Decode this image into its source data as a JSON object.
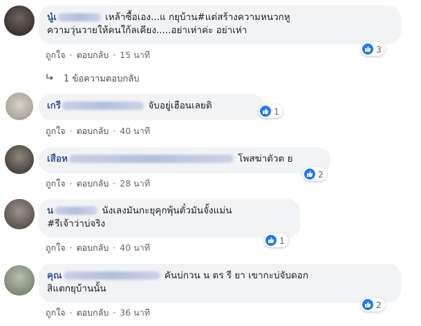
{
  "comments": [
    {
      "author": "นู๋เ",
      "text": "เหล้าซื้อเอง...แ  กยุบ้าน#แต่สร้างความหนวกหู",
      "text2": "ความวุ่นวายให้คนใก้ลเคียง.....อย่าเห่าค่ะ อย่าเห่า",
      "like": "ถูกใจ",
      "reply": "ตอบกลับ",
      "time": "15 นาที",
      "reactions": "3"
    },
    {
      "author": "เกรี",
      "text": "จับอยู่เฮือนเลยติ",
      "like": "ถูกใจ",
      "reply": "ตอบกลับ",
      "time": "40 นาที",
      "reactions": "1"
    },
    {
      "author": "เสือห",
      "text": "โพสฆ่าตัวต  ย",
      "like": "ถูกใจ",
      "reply": "ตอบกลับ",
      "time": "28 นาที",
      "reactions": "2"
    },
    {
      "author": "น",
      "text": "นังเลงมันกะยุคุกพุ้นตั๋วมันจั้งแม่น",
      "text2": "#รีเจ้าว่าบ่จริง",
      "like": "ถูกใจ",
      "reply": "ตอบกลับ",
      "time": "40 นาที",
      "reactions": "1"
    },
    {
      "author": "คุณ",
      "text": "คันบ่กวน   น ตร รี ยา เขากะบ่จับดอก",
      "text2": "สิแตกยุบ้านนั้น",
      "like": "ถูกใจ",
      "reply": "ตอบกลับ",
      "time": "36 นาที",
      "reactions": "2"
    }
  ],
  "replies_link": "1 ข้อความตอบกลับ",
  "colors": {
    "like_blue": "#2078f4",
    "author_blue": "#385898",
    "bubble_bg": "#f2f3f5"
  }
}
